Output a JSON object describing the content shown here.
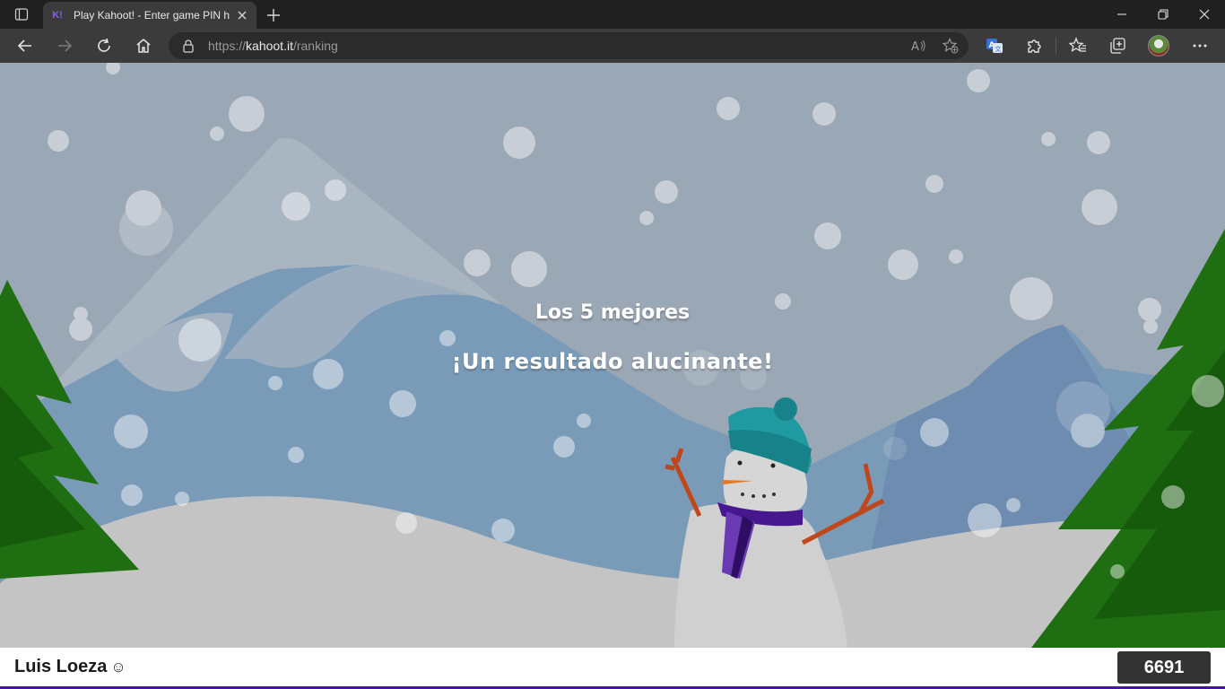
{
  "browser": {
    "tab": {
      "favicon_label": "K!",
      "title": "Play Kahoot! - Enter game PIN he"
    },
    "address_bar": {
      "scheme": "https://",
      "host": "kahoot.it",
      "path": "/ranking"
    },
    "icons": {
      "tab_actions": "tab-actions-icon",
      "new_tab": "plus-icon",
      "back": "back-arrow-icon",
      "forward": "forward-arrow-icon",
      "refresh": "refresh-icon",
      "home": "home-icon",
      "read_aloud": "read-aloud-icon",
      "favorite_add": "star-add-icon",
      "translate": "translate-icon",
      "extensions": "puzzle-icon",
      "favorites": "favorites-icon",
      "collections": "collections-icon",
      "menu": "more-dots-icon"
    }
  },
  "page": {
    "subtitle": "Los 5 mejores",
    "headline": "¡Un resultado alucinante!",
    "player_name": "Luis Loeza",
    "player_emoji": "☺",
    "score": "6691"
  },
  "colors": {
    "sky": "#9aa7b4",
    "mountain_back": "#7a9bb8",
    "snow_ground": "#c4c4c4",
    "tree": "#1f6e12",
    "kahoot_purple": "#46178f",
    "score_bg": "#333333"
  }
}
